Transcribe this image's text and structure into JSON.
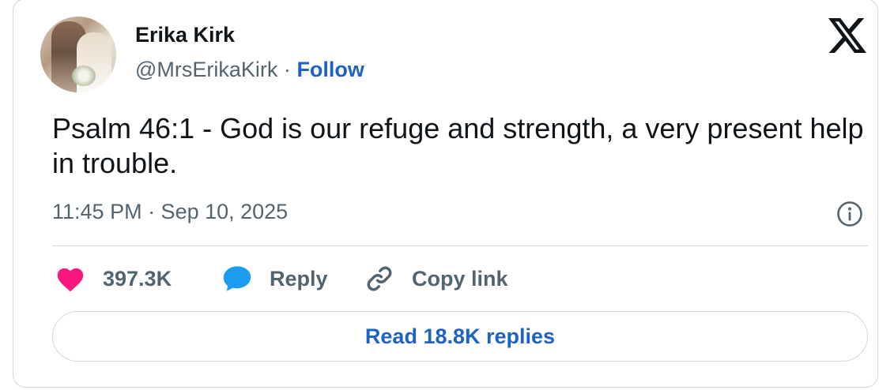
{
  "author": {
    "name": "Erika Kirk",
    "handle": "@MrsErikaKirk",
    "separator": "·",
    "follow_label": "Follow"
  },
  "tweet": {
    "text": "Psalm 46:1 - God is our refuge and strength, a very present help in trouble.",
    "timestamp": "11:45 PM · Sep 10, 2025"
  },
  "actions": {
    "like_count": "397.3K",
    "reply_label": "Reply",
    "copy_link_label": "Copy link"
  },
  "read_replies_label": "Read 18.8K replies",
  "icons": {
    "logo": "x-logo-icon",
    "info": "info-icon",
    "like": "heart-icon",
    "reply": "speech-bubble-icon",
    "copy": "link-icon"
  },
  "colors": {
    "text_primary": "#0f1419",
    "text_secondary": "#536471",
    "link": "#1d62c7",
    "heart": "#f91880",
    "reply_bubble": "#1d9bf0",
    "border": "#cfd9de"
  }
}
